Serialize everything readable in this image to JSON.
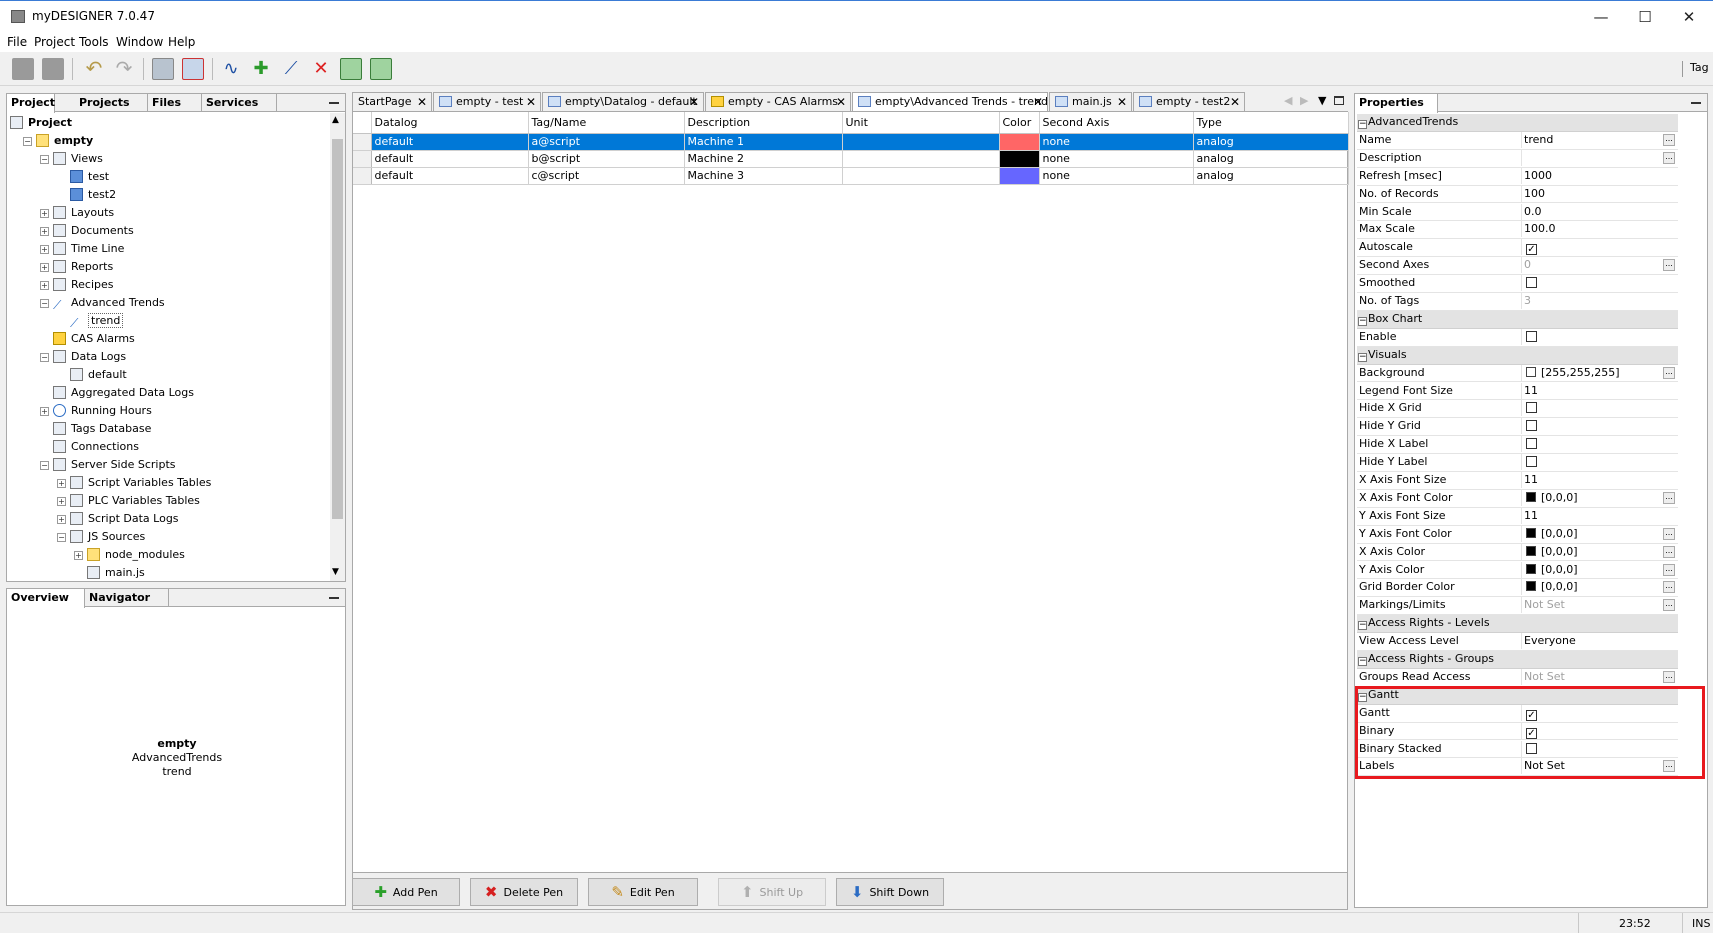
{
  "window": {
    "title": "myDESIGNER 7.0.47",
    "minimize": "—",
    "maximize": "☐",
    "close": "✕"
  },
  "menu": [
    "File",
    "Project",
    "Tools",
    "Window",
    "Help"
  ],
  "toolbar": {
    "right_label": "Tag"
  },
  "left_panel": {
    "tabs": [
      "Project",
      "Projects",
      "Files",
      "Services"
    ],
    "tree": [
      {
        "label": "Project",
        "depth": 0,
        "bold": true,
        "icon": "project-icon"
      },
      {
        "label": "empty",
        "depth": 1,
        "bold": true,
        "icon": "folder-icon",
        "exp": "-"
      },
      {
        "label": "Views",
        "depth": 2,
        "icon": "views-icon",
        "exp": "-"
      },
      {
        "label": "test",
        "depth": 3,
        "icon": "screen-icon"
      },
      {
        "label": "test2",
        "depth": 3,
        "icon": "screen-icon"
      },
      {
        "label": "Layouts",
        "depth": 2,
        "icon": "layout-icon",
        "exp": "+"
      },
      {
        "label": "Documents",
        "depth": 2,
        "icon": "document-icon",
        "exp": "+"
      },
      {
        "label": "Time Line",
        "depth": 2,
        "icon": "timeline-icon",
        "exp": "+"
      },
      {
        "label": "Reports",
        "depth": 2,
        "icon": "report-icon",
        "exp": "+"
      },
      {
        "label": "Recipes",
        "depth": 2,
        "icon": "recipe-icon",
        "exp": "+"
      },
      {
        "label": "Advanced Trends",
        "depth": 2,
        "icon": "trend-icon",
        "exp": "-"
      },
      {
        "label": "trend",
        "depth": 3,
        "icon": "trend-icon",
        "selected": true
      },
      {
        "label": "CAS Alarms",
        "depth": 2,
        "icon": "alarm-bell-icon"
      },
      {
        "label": "Data Logs",
        "depth": 2,
        "icon": "datalog-icon",
        "exp": "-"
      },
      {
        "label": "default",
        "depth": 3,
        "icon": "datalog-icon"
      },
      {
        "label": "Aggregated Data Logs",
        "depth": 2,
        "icon": "datalog-icon"
      },
      {
        "label": "Running Hours",
        "depth": 2,
        "icon": "clock-icon",
        "exp": "+"
      },
      {
        "label": "Tags Database",
        "depth": 2,
        "icon": "database-icon"
      },
      {
        "label": "Connections",
        "depth": 2,
        "icon": "connection-icon"
      },
      {
        "label": "Server Side Scripts",
        "depth": 2,
        "icon": "script-icon",
        "exp": "-"
      },
      {
        "label": "Script Variables Tables",
        "depth": 3,
        "icon": "table-icon",
        "exp": "+"
      },
      {
        "label": "PLC Variables Tables",
        "depth": 3,
        "icon": "table-icon",
        "exp": "+"
      },
      {
        "label": "Script Data Logs",
        "depth": 3,
        "icon": "datalog-icon",
        "exp": "+"
      },
      {
        "label": "JS Sources",
        "depth": 3,
        "icon": "js-icon",
        "exp": "-"
      },
      {
        "label": "node_modules",
        "depth": 4,
        "icon": "folder-icon",
        "exp": "+"
      },
      {
        "label": "main.js",
        "depth": 4,
        "icon": "file-icon"
      }
    ]
  },
  "overview_panel": {
    "tabs": [
      "Overview",
      "Navigator"
    ],
    "lines": [
      "empty",
      "AdvancedTrends",
      "trend"
    ]
  },
  "editor": {
    "tabs": [
      {
        "label": "StartPage",
        "icon": ""
      },
      {
        "label": "empty - test",
        "icon": "screen-icon"
      },
      {
        "label": "empty\\Datalog - default",
        "icon": "datalog-icon"
      },
      {
        "label": "empty - CAS Alarms",
        "icon": "alarm-bell-icon"
      },
      {
        "label": "empty\\Advanced Trends - trend",
        "icon": "trend-icon",
        "active": true
      },
      {
        "label": "main.js",
        "icon": "js-icon"
      },
      {
        "label": "empty - test2",
        "icon": "screen-icon"
      }
    ],
    "columns": [
      "Datalog",
      "Tag/Name",
      "Description",
      "Unit",
      "Color",
      "Second Axis",
      "Type"
    ],
    "rows": [
      {
        "datalog": "default",
        "tag": "a@script",
        "description": "Machine 1",
        "unit": "",
        "color": "#ff6666",
        "second_axis": "none",
        "type": "analog",
        "selected": true
      },
      {
        "datalog": "default",
        "tag": "b@script",
        "description": "Machine 2",
        "unit": "",
        "color": "#000000",
        "second_axis": "none",
        "type": "analog"
      },
      {
        "datalog": "default",
        "tag": "c@script",
        "description": "Machine 3",
        "unit": "",
        "color": "#6666ff",
        "second_axis": "none",
        "type": "analog"
      }
    ],
    "buttons": [
      {
        "label": "Add Pen",
        "icon": "plus-icon",
        "enabled": true
      },
      {
        "label": "Delete Pen",
        "icon": "delete-x-icon",
        "enabled": true
      },
      {
        "label": "Edit Pen",
        "icon": "pencil-icon",
        "enabled": true
      },
      {
        "label": "Shift Up",
        "icon": "arrow-up-icon",
        "enabled": false
      },
      {
        "label": "Shift Down",
        "icon": "arrow-down-icon",
        "enabled": true
      }
    ]
  },
  "properties": {
    "title": "Properties",
    "rows": [
      {
        "cat": "AdvancedTrends"
      },
      {
        "k": "Name",
        "v": "trend",
        "dots": true
      },
      {
        "k": "Description",
        "v": "",
        "dots": true
      },
      {
        "k": "Refresh [msec]",
        "v": "1000"
      },
      {
        "k": "No. of Records",
        "v": "100"
      },
      {
        "k": "Min Scale",
        "v": "0.0"
      },
      {
        "k": "Max Scale",
        "v": "100.0"
      },
      {
        "k": "Autoscale",
        "check": true
      },
      {
        "k": "Second Axes",
        "v": "0",
        "gray": true,
        "dots": true
      },
      {
        "k": "Smoothed",
        "check": false
      },
      {
        "k": "No. of Tags",
        "v": "3",
        "gray": true
      },
      {
        "cat": "Box Chart"
      },
      {
        "k": "Enable",
        "check": false
      },
      {
        "cat": "Visuals"
      },
      {
        "k": "Background",
        "v": "[255,255,255]",
        "swatch": "#ffffff",
        "dots": true
      },
      {
        "k": "Legend Font Size",
        "v": "11"
      },
      {
        "k": "Hide X Grid",
        "check": false
      },
      {
        "k": "Hide Y Grid",
        "check": false
      },
      {
        "k": "Hide X Label",
        "check": false
      },
      {
        "k": "Hide Y Label",
        "check": false
      },
      {
        "k": "X Axis Font Size",
        "v": "11"
      },
      {
        "k": "X Axis Font Color",
        "v": "[0,0,0]",
        "swatch": "#000000",
        "dots": true
      },
      {
        "k": "Y Axis Font Size",
        "v": "11"
      },
      {
        "k": "Y Axis Font Color",
        "v": "[0,0,0]",
        "swatch": "#000000",
        "dots": true
      },
      {
        "k": "X Axis Color",
        "v": "[0,0,0]",
        "swatch": "#000000",
        "dots": true
      },
      {
        "k": "Y Axis Color",
        "v": "[0,0,0]",
        "swatch": "#000000",
        "dots": true
      },
      {
        "k": "Grid Border Color",
        "v": "[0,0,0]",
        "swatch": "#000000",
        "dots": true
      },
      {
        "k": "Markings/Limits",
        "v": "Not Set",
        "gray": true,
        "dots": true
      },
      {
        "cat": "Access Rights - Levels"
      },
      {
        "k": "View Access Level",
        "v": "Everyone"
      },
      {
        "cat": "Access Rights - Groups"
      },
      {
        "k": "Groups Read Access",
        "v": "Not Set",
        "gray": true,
        "dots": true
      },
      {
        "cat": "Gantt"
      },
      {
        "k": "Gantt",
        "check": true
      },
      {
        "k": "Binary",
        "check": true
      },
      {
        "k": "Binary Stacked",
        "check": false
      },
      {
        "k": "Labels",
        "v": "Not Set",
        "dots": true
      }
    ]
  },
  "status": {
    "time": "23:52",
    "mode": "INS"
  },
  "colors": {
    "selection": "#0078d7",
    "highlight": "#e8191e"
  }
}
